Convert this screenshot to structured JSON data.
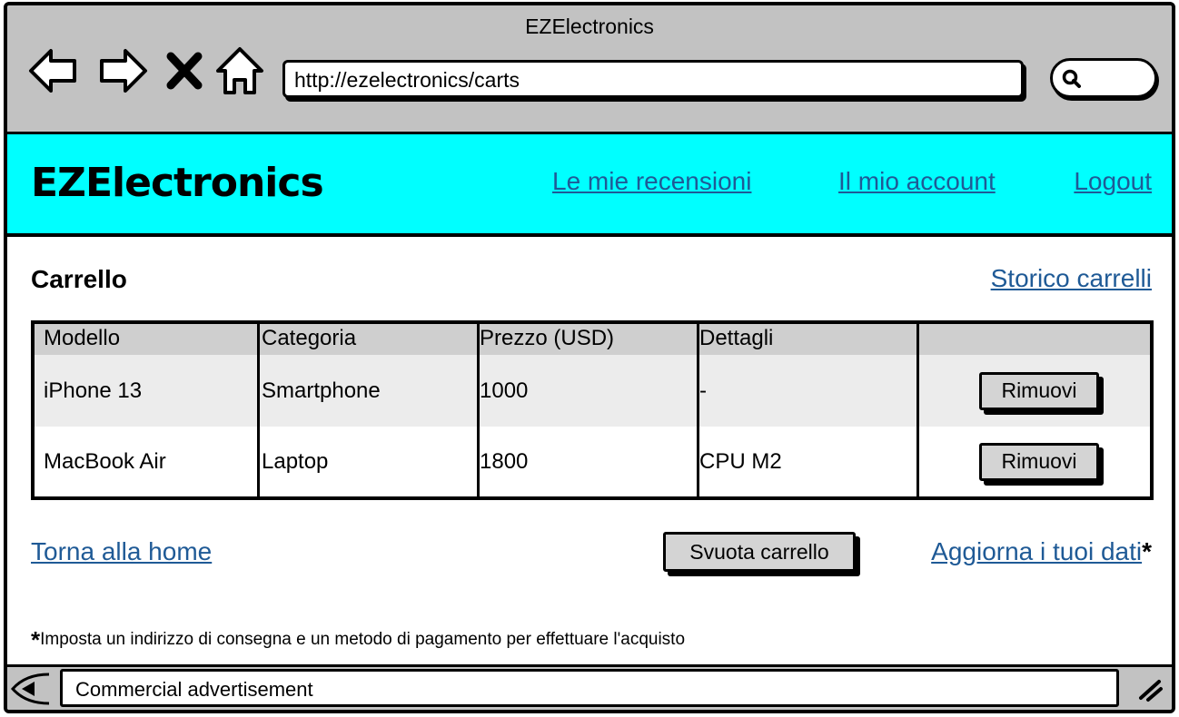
{
  "window": {
    "title": "EZElectronics"
  },
  "browser": {
    "url": "http://ezelectronics/carts"
  },
  "header": {
    "brand": "EZElectronics",
    "links": {
      "reviews": "Le mie recensioni",
      "account": "Il mio account",
      "logout": "Logout"
    },
    "color": "#00ffff"
  },
  "cart": {
    "title": "Carrello",
    "history_link": "Storico carrelli",
    "columns": [
      "Modello",
      "Categoria",
      "Prezzo (USD)",
      "Dettagli",
      ""
    ],
    "rows": [
      {
        "model": "iPhone 13",
        "category": "Smartphone",
        "price": "1000",
        "details": "-",
        "action": "Rimuovi"
      },
      {
        "model": "MacBook Air",
        "category": "Laptop",
        "price": "1800",
        "details": "CPU M2",
        "action": "Rimuovi"
      }
    ]
  },
  "actions": {
    "home_link": "Torna alla home",
    "clear_button": "Svuota carrello",
    "update_link": "Aggiorna i tuoi dati",
    "update_mark": "*"
  },
  "footnote": {
    "mark": "*",
    "text": "Imposta un indirizzo di consegna e un metodo di pagamento per effettuare l'acquisto"
  },
  "bottom_bar": {
    "ad": "Commercial advertisement"
  },
  "icons": [
    "back-arrow-icon",
    "forward-arrow-icon",
    "stop-icon",
    "home-icon",
    "search-icon",
    "scroll-left-icon",
    "resize-handle-icon"
  ],
  "link_color": "#1f5a96"
}
